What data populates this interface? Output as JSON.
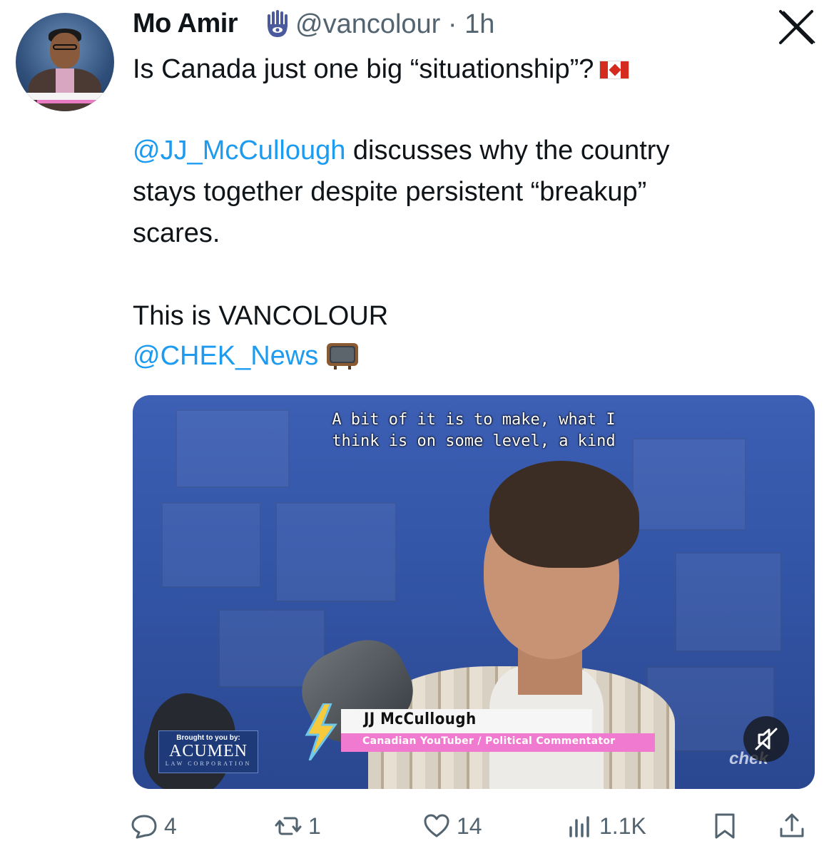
{
  "tweet": {
    "author_name": "Mo Amir",
    "handle": "@vancolour",
    "separator": "·",
    "time": "1h",
    "line1": "Is Canada just one big “situationship”?",
    "mention1": "@JJ_McCullough",
    "line2_rest": " discusses why the country",
    "line3": "stays together despite persistent “breakup”",
    "line4": "scares.",
    "line5": "This is VANCOLOUR",
    "mention2": "@CHEK_News"
  },
  "video": {
    "caption_line1": "A bit of it is to make, what I",
    "caption_line2": "think is on some level, a kind",
    "lower_third_name": "JJ McCullough",
    "lower_third_title": "Canadian YouTuber / Political Commentator",
    "sponsor_by": "Brought to you by:",
    "sponsor_brand": "ACUMEN",
    "sponsor_sub": "LAW CORPORATION",
    "watermark": "chek"
  },
  "actions": {
    "replies": "4",
    "reposts": "1",
    "likes": "14",
    "views": "1.1K"
  },
  "colors": {
    "link": "#1d9bf0",
    "muted_text": "#536471",
    "lower_third_pink": "#f07ad0"
  },
  "icons": [
    "hamsa-icon",
    "x-close-icon",
    "canada-flag-icon",
    "television-icon",
    "mute-icon",
    "reply-icon",
    "repost-icon",
    "like-icon",
    "views-icon",
    "bookmark-icon",
    "share-icon"
  ]
}
